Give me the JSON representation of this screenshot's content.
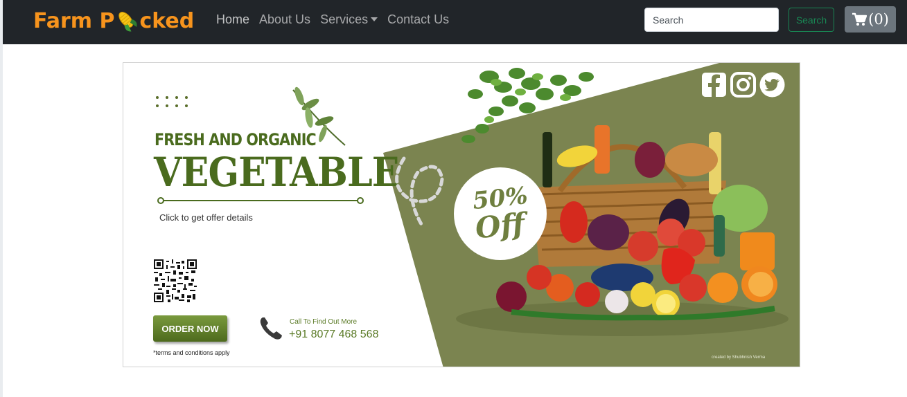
{
  "navbar": {
    "brand_prefix": "Farm P",
    "brand_suffix": "cked",
    "brand_icon": "corn-icon",
    "links": [
      {
        "label": "Home"
      },
      {
        "label": "About Us"
      },
      {
        "label": "Services"
      },
      {
        "label": "Contact Us"
      }
    ],
    "search": {
      "placeholder": "Search",
      "button_label": "Search"
    },
    "cart": {
      "icon": "cart-icon",
      "label": "(0)"
    }
  },
  "banner": {
    "headline_small": "FRESH AND ORGANIC",
    "headline_big": "VEGETABLE",
    "offer_link": "Click to get offer details",
    "order_button": "ORDER NOW",
    "terms": "*terms and conditions apply",
    "call_label": "Call To Find Out More",
    "call_number": "+91 8077 468 568",
    "discount_percent": "50%",
    "discount_word": "Off",
    "credit": "created by Shubhnish Verma",
    "social_icons": [
      "facebook-icon",
      "instagram-icon",
      "twitter-icon"
    ],
    "colors": {
      "brand_orange": "#f7941d",
      "olive_green": "#7a8650",
      "text_green": "#4a6b1e"
    }
  }
}
